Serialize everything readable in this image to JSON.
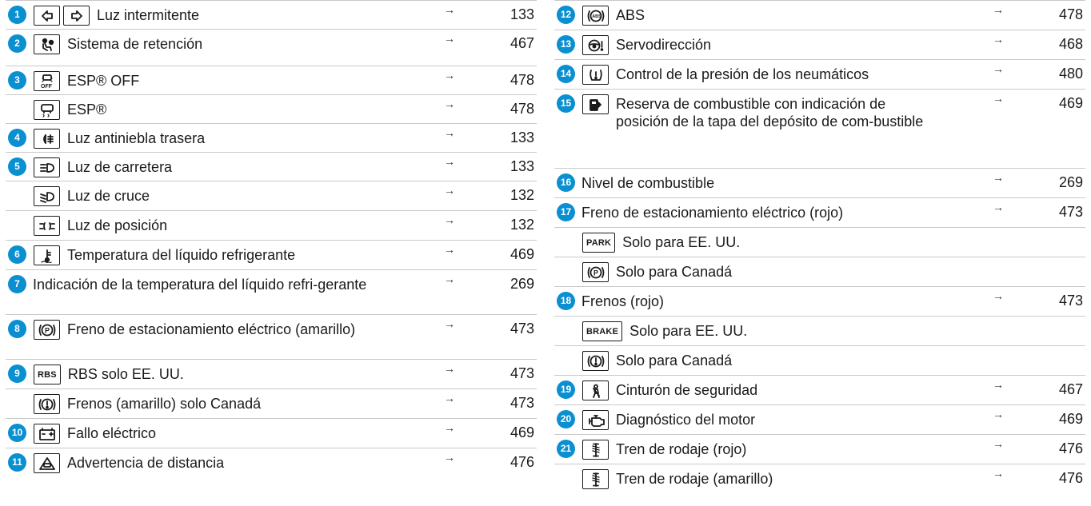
{
  "left": [
    {
      "num": "1",
      "icons": [
        "turn-left-icon",
        "turn-right-icon"
      ],
      "text": "Luz intermitente",
      "page": "133",
      "arrow": "→"
    },
    {
      "num": "2",
      "icons": [
        "airbag-icon"
      ],
      "text": "Sistema de retención",
      "page": "467",
      "arrow": "→"
    },
    {
      "num": "3",
      "icons": [
        "esp-off-icon"
      ],
      "text": "ESP® OFF",
      "page": "478",
      "arrow": "→"
    },
    {
      "num": "",
      "icons": [
        "esp-icon"
      ],
      "text": "ESP®",
      "page": "478",
      "arrow": "→"
    },
    {
      "num": "4",
      "icons": [
        "rear-fog-icon"
      ],
      "text": "Luz antiniebla trasera",
      "page": "133",
      "arrow": "→"
    },
    {
      "num": "5",
      "icons": [
        "high-beam-icon"
      ],
      "text": "Luz de carretera",
      "page": "133",
      "arrow": "→"
    },
    {
      "num": "",
      "icons": [
        "low-beam-icon"
      ],
      "text": "Luz de cruce",
      "page": "132",
      "arrow": "→"
    },
    {
      "num": "",
      "icons": [
        "parking-light-icon"
      ],
      "text": "Luz de posición",
      "page": "132",
      "arrow": "→"
    },
    {
      "num": "6",
      "icons": [
        "coolant-temp-icon"
      ],
      "text": "Temperatura del líquido refrigerante",
      "page": "469",
      "arrow": "→"
    },
    {
      "num": "7",
      "icons": [],
      "text": "Indicación de la temperatura del líquido refri-gerante",
      "page": "269",
      "arrow": "→"
    },
    {
      "num": "8",
      "icons": [
        "park-brake-p-icon"
      ],
      "text": "Freno de estacionamiento eléctrico (amarillo)",
      "page": "473",
      "arrow": "→"
    },
    {
      "num": "9",
      "icons": [
        "rbs-icon"
      ],
      "text": "RBS solo EE. UU.",
      "page": "473",
      "arrow": "→"
    },
    {
      "num": "",
      "icons": [
        "brake-warning-icon"
      ],
      "text": "Frenos (amarillo) solo Canadá",
      "page": "473",
      "arrow": "→"
    },
    {
      "num": "10",
      "icons": [
        "battery-icon"
      ],
      "text": "Fallo eléctrico",
      "page": "469",
      "arrow": "→"
    },
    {
      "num": "11",
      "icons": [
        "distance-warning-icon"
      ],
      "text": "Advertencia de distancia",
      "page": "476",
      "arrow": "→"
    }
  ],
  "right": [
    {
      "num": "12",
      "icons": [
        "abs-icon"
      ],
      "text": "ABS",
      "page": "478",
      "arrow": "→"
    },
    {
      "num": "13",
      "icons": [
        "steering-icon"
      ],
      "text": "Servodirección",
      "page": "468",
      "arrow": "→"
    },
    {
      "num": "14",
      "icons": [
        "tire-pressure-icon"
      ],
      "text": "Control de la presión de los neumáticos",
      "page": "480",
      "arrow": "→"
    },
    {
      "num": "15",
      "icons": [
        "fuel-icon"
      ],
      "text": "Reserva de combustible con indicación de posición de la tapa del depósito de com-bustible",
      "page": "469",
      "arrow": "→"
    },
    {
      "num": "16",
      "icons": [],
      "text": "Nivel de combustible",
      "page": "269",
      "arrow": "→"
    },
    {
      "num": "17",
      "icons": [],
      "text": "Freno de estacionamiento eléctrico (rojo)",
      "page": "473",
      "arrow": "→"
    },
    {
      "num": "",
      "icons": [
        "park-word-icon"
      ],
      "text": "Solo para EE. UU.",
      "page": "",
      "arrow": ""
    },
    {
      "num": "",
      "icons": [
        "park-brake-p-icon"
      ],
      "text": "Solo para Canadá",
      "page": "",
      "arrow": ""
    },
    {
      "num": "18",
      "icons": [],
      "text": "Frenos (rojo)",
      "page": "473",
      "arrow": "→"
    },
    {
      "num": "",
      "icons": [
        "brake-word-icon"
      ],
      "text": "Solo para EE. UU.",
      "page": "",
      "arrow": ""
    },
    {
      "num": "",
      "icons": [
        "brake-warning-icon"
      ],
      "text": "Solo para Canadá",
      "page": "",
      "arrow": ""
    },
    {
      "num": "19",
      "icons": [
        "seatbelt-icon"
      ],
      "text": "Cinturón de seguridad",
      "page": "467",
      "arrow": "→"
    },
    {
      "num": "20",
      "icons": [
        "engine-icon"
      ],
      "text": "Diagnóstico del motor",
      "page": "469",
      "arrow": "→"
    },
    {
      "num": "21",
      "icons": [
        "suspension-icon"
      ],
      "text": "Tren de rodaje (rojo)",
      "page": "476",
      "arrow": "→"
    },
    {
      "num": "",
      "icons": [
        "suspension-icon"
      ],
      "text": "Tren de rodaje (amarillo)",
      "page": "476",
      "arrow": "→"
    }
  ],
  "icon_words": {
    "rbs-icon": "RBS",
    "park-word-icon": "PARK",
    "brake-word-icon": "BRAKE"
  },
  "colors": {
    "number_badge": "#0a8fd1",
    "rule": "#c9c9c9"
  }
}
